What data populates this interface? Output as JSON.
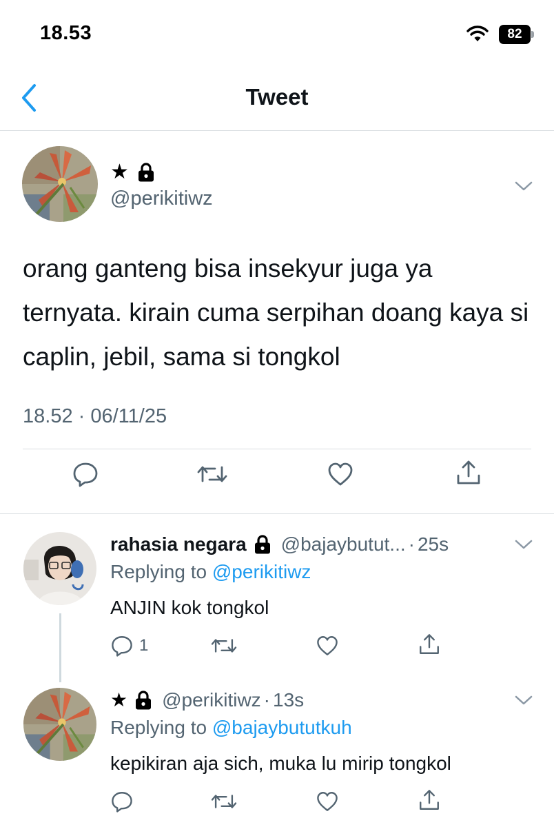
{
  "status_bar": {
    "time": "18.53",
    "battery": "82",
    "icons": [
      "wifi-icon",
      "battery-icon"
    ]
  },
  "nav": {
    "title": "Tweet",
    "back_icon": "chevron-left-icon"
  },
  "main_tweet": {
    "name_symbol": "★",
    "handle": "@perikitiwz",
    "text": "orang ganteng bisa insekyur juga ya ternyata. kirain cuma serpihan doang kaya si caplin, jebil, sama si tongkol",
    "timestamp": "18.52 · 06/11/25",
    "actions": [
      "reply-icon",
      "retweet-icon",
      "like-icon",
      "share-icon"
    ]
  },
  "replies": [
    {
      "name": "rahasia negara",
      "handle": "@bajaybutut...",
      "dot": "·",
      "age": "25s",
      "replying_prefix": "Replying to ",
      "replying_to": "@perikitiwz",
      "text": "ANJIN kok tongkol",
      "reply_count": "1"
    },
    {
      "name_symbol": "★",
      "handle": "@perikitiwz",
      "dot": "·",
      "age": "13s",
      "replying_prefix": "Replying to ",
      "replying_to": "@bajaybututkuh",
      "text": "kepikiran aja sich, muka lu mirip tongkol",
      "reply_count": ""
    }
  ],
  "colors": {
    "accent": "#1d9bf0",
    "secondary_text": "#536471",
    "divider": "#d9dde1"
  }
}
